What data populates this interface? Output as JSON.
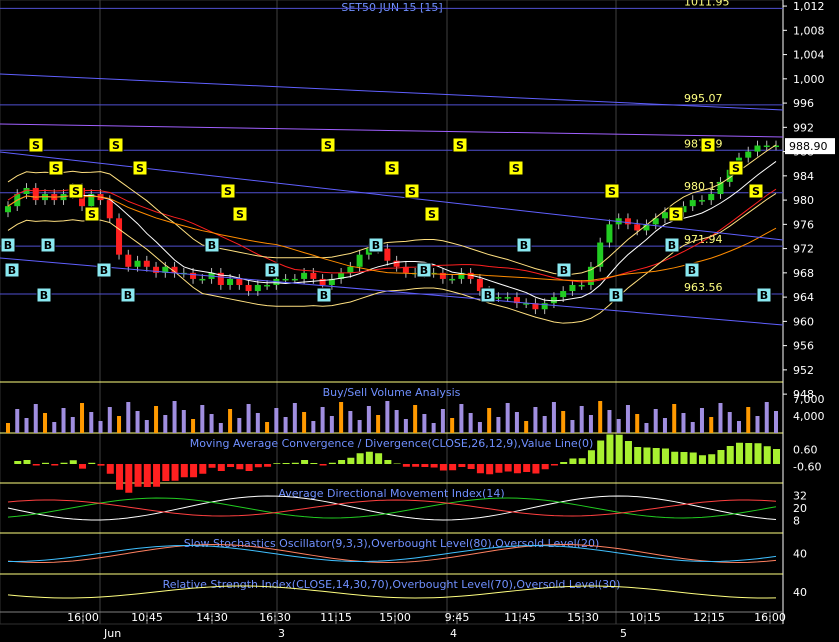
{
  "chart_data": {
    "type": "candlestick",
    "title": "SET50 JUN 15  [15]",
    "price_axis": {
      "range": [
        950,
        1013
      ],
      "ticks": [
        1012,
        1008,
        1004,
        1000,
        996,
        992,
        988,
        984,
        980,
        976,
        972,
        968,
        964,
        960,
        956,
        952,
        948
      ]
    },
    "last_price": "988.90",
    "level_labels": [
      {
        "text": "1011.95",
        "value": 1012.6
      },
      {
        "text": "995.07",
        "value": 996.7
      },
      {
        "text": "987.39",
        "value": 989.2
      },
      {
        "text": "980.11",
        "value": 982.2
      },
      {
        "text": "971.94",
        "value": 973.4
      },
      {
        "text": "963.56",
        "value": 965.5
      }
    ],
    "time_axis": {
      "time_labels": [
        "16:00",
        "10:45",
        "14:30",
        "16:30",
        "11:15",
        "15:00",
        "9:45",
        "11:45",
        "15:30",
        "10:15",
        "12:15",
        "16:00"
      ],
      "date_labels": [
        "Jun",
        "3",
        "4",
        "5"
      ]
    },
    "close_series": [
      979,
      981,
      982,
      980,
      981,
      980,
      981,
      982,
      979,
      981,
      980,
      977,
      971,
      969,
      970,
      969,
      968,
      969,
      968,
      968,
      967,
      967,
      968,
      966,
      967,
      966,
      965,
      966,
      966,
      967,
      967,
      967,
      968,
      967,
      966,
      967,
      968,
      969,
      971,
      972,
      972,
      970,
      969,
      968,
      968,
      968,
      968,
      967,
      967,
      968,
      967,
      965,
      964,
      964,
      964,
      963,
      963,
      962,
      963,
      964,
      965,
      966,
      966,
      969,
      973,
      976,
      977,
      976,
      975,
      976,
      977,
      978,
      978,
      979,
      980,
      980,
      981,
      983,
      985,
      987,
      988,
      989,
      989,
      989
    ],
    "buy_signals": [
      0,
      1,
      9,
      10,
      24,
      30,
      51,
      66,
      79,
      92,
      104,
      120,
      129,
      139,
      152,
      166,
      171,
      189
    ],
    "sell_signals": [
      7,
      12,
      17,
      21,
      27,
      33,
      55,
      58,
      80,
      96,
      101,
      106,
      113,
      127,
      151,
      167,
      175,
      182,
      187
    ],
    "panels": [
      {
        "title": "Buy/Sell Volume Analysis",
        "ticks": [
          "7,000",
          "4,000"
        ]
      },
      {
        "title": "Moving Average Convergence / Divergence(CLOSE,26,12,9),Value Line(0)",
        "ticks": [
          "0.60",
          "-0.60"
        ]
      },
      {
        "title": "Average Directional Movement Index(14)",
        "ticks": [
          "32",
          "20",
          "8"
        ]
      },
      {
        "title": "Slow Stochastics Oscillator(9,3,3),Overbought Level(80),Oversold Level(20)",
        "ticks": [
          "40"
        ]
      },
      {
        "title": "Relative Strength Index(CLOSE,14,30,70),Overbought Level(70),Oversold Level(30)",
        "ticks": [
          "40"
        ]
      }
    ],
    "colors": {
      "up": "#22cc22",
      "down": "#ff2020",
      "buy_badge": "#8ae8f0",
      "sell_badge": "#ffff00",
      "title": "#7090ff",
      "level": "#ffff80",
      "volume_buy": "#a08ee0",
      "volume_sell": "#ff9900"
    }
  }
}
